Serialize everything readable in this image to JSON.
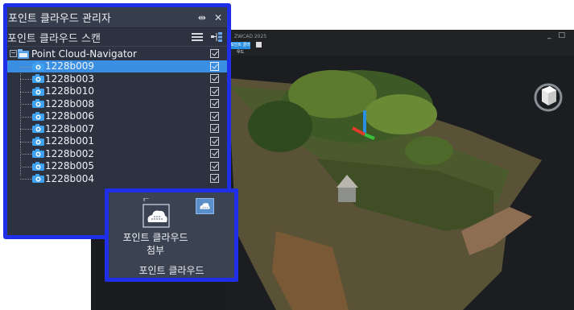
{
  "viewport": {
    "title": "ZWCAD 2025",
    "chip_label": "포인트 클라우드",
    "window_controls": "_ □"
  },
  "panel": {
    "title": "포인트 클라우드 관리자",
    "scan_label": "포인트 클라우드 스캔",
    "icons": [
      "pin-icon",
      "close-icon",
      "list-icon",
      "tree-icon"
    ]
  },
  "tree": {
    "root": {
      "label": "Point Cloud-Navigator",
      "checked": true,
      "icon": "folder-icon"
    },
    "scans": [
      {
        "label": "1228b009",
        "checked": true,
        "selected": true
      },
      {
        "label": "1228b003",
        "checked": true
      },
      {
        "label": "1228b010",
        "checked": true
      },
      {
        "label": "1228b008",
        "checked": true
      },
      {
        "label": "1228b006",
        "checked": true
      },
      {
        "label": "1228b007",
        "checked": true
      },
      {
        "label": "1228b001",
        "checked": true
      },
      {
        "label": "1228b002",
        "checked": true
      },
      {
        "label": "1228b005",
        "checked": true
      },
      {
        "label": "1228b004",
        "checked": true
      }
    ]
  },
  "ribbon": {
    "attach_label": "포인트 클라우드\n첨부",
    "group_label": "포인트 클라우드",
    "icons": [
      "attach-pointcloud-icon",
      "pointcloud-small-icon"
    ]
  },
  "colors": {
    "highlight_border": "#1f2fe8",
    "selection": "#3a8fe3",
    "panel_bg": "#2c3240"
  }
}
